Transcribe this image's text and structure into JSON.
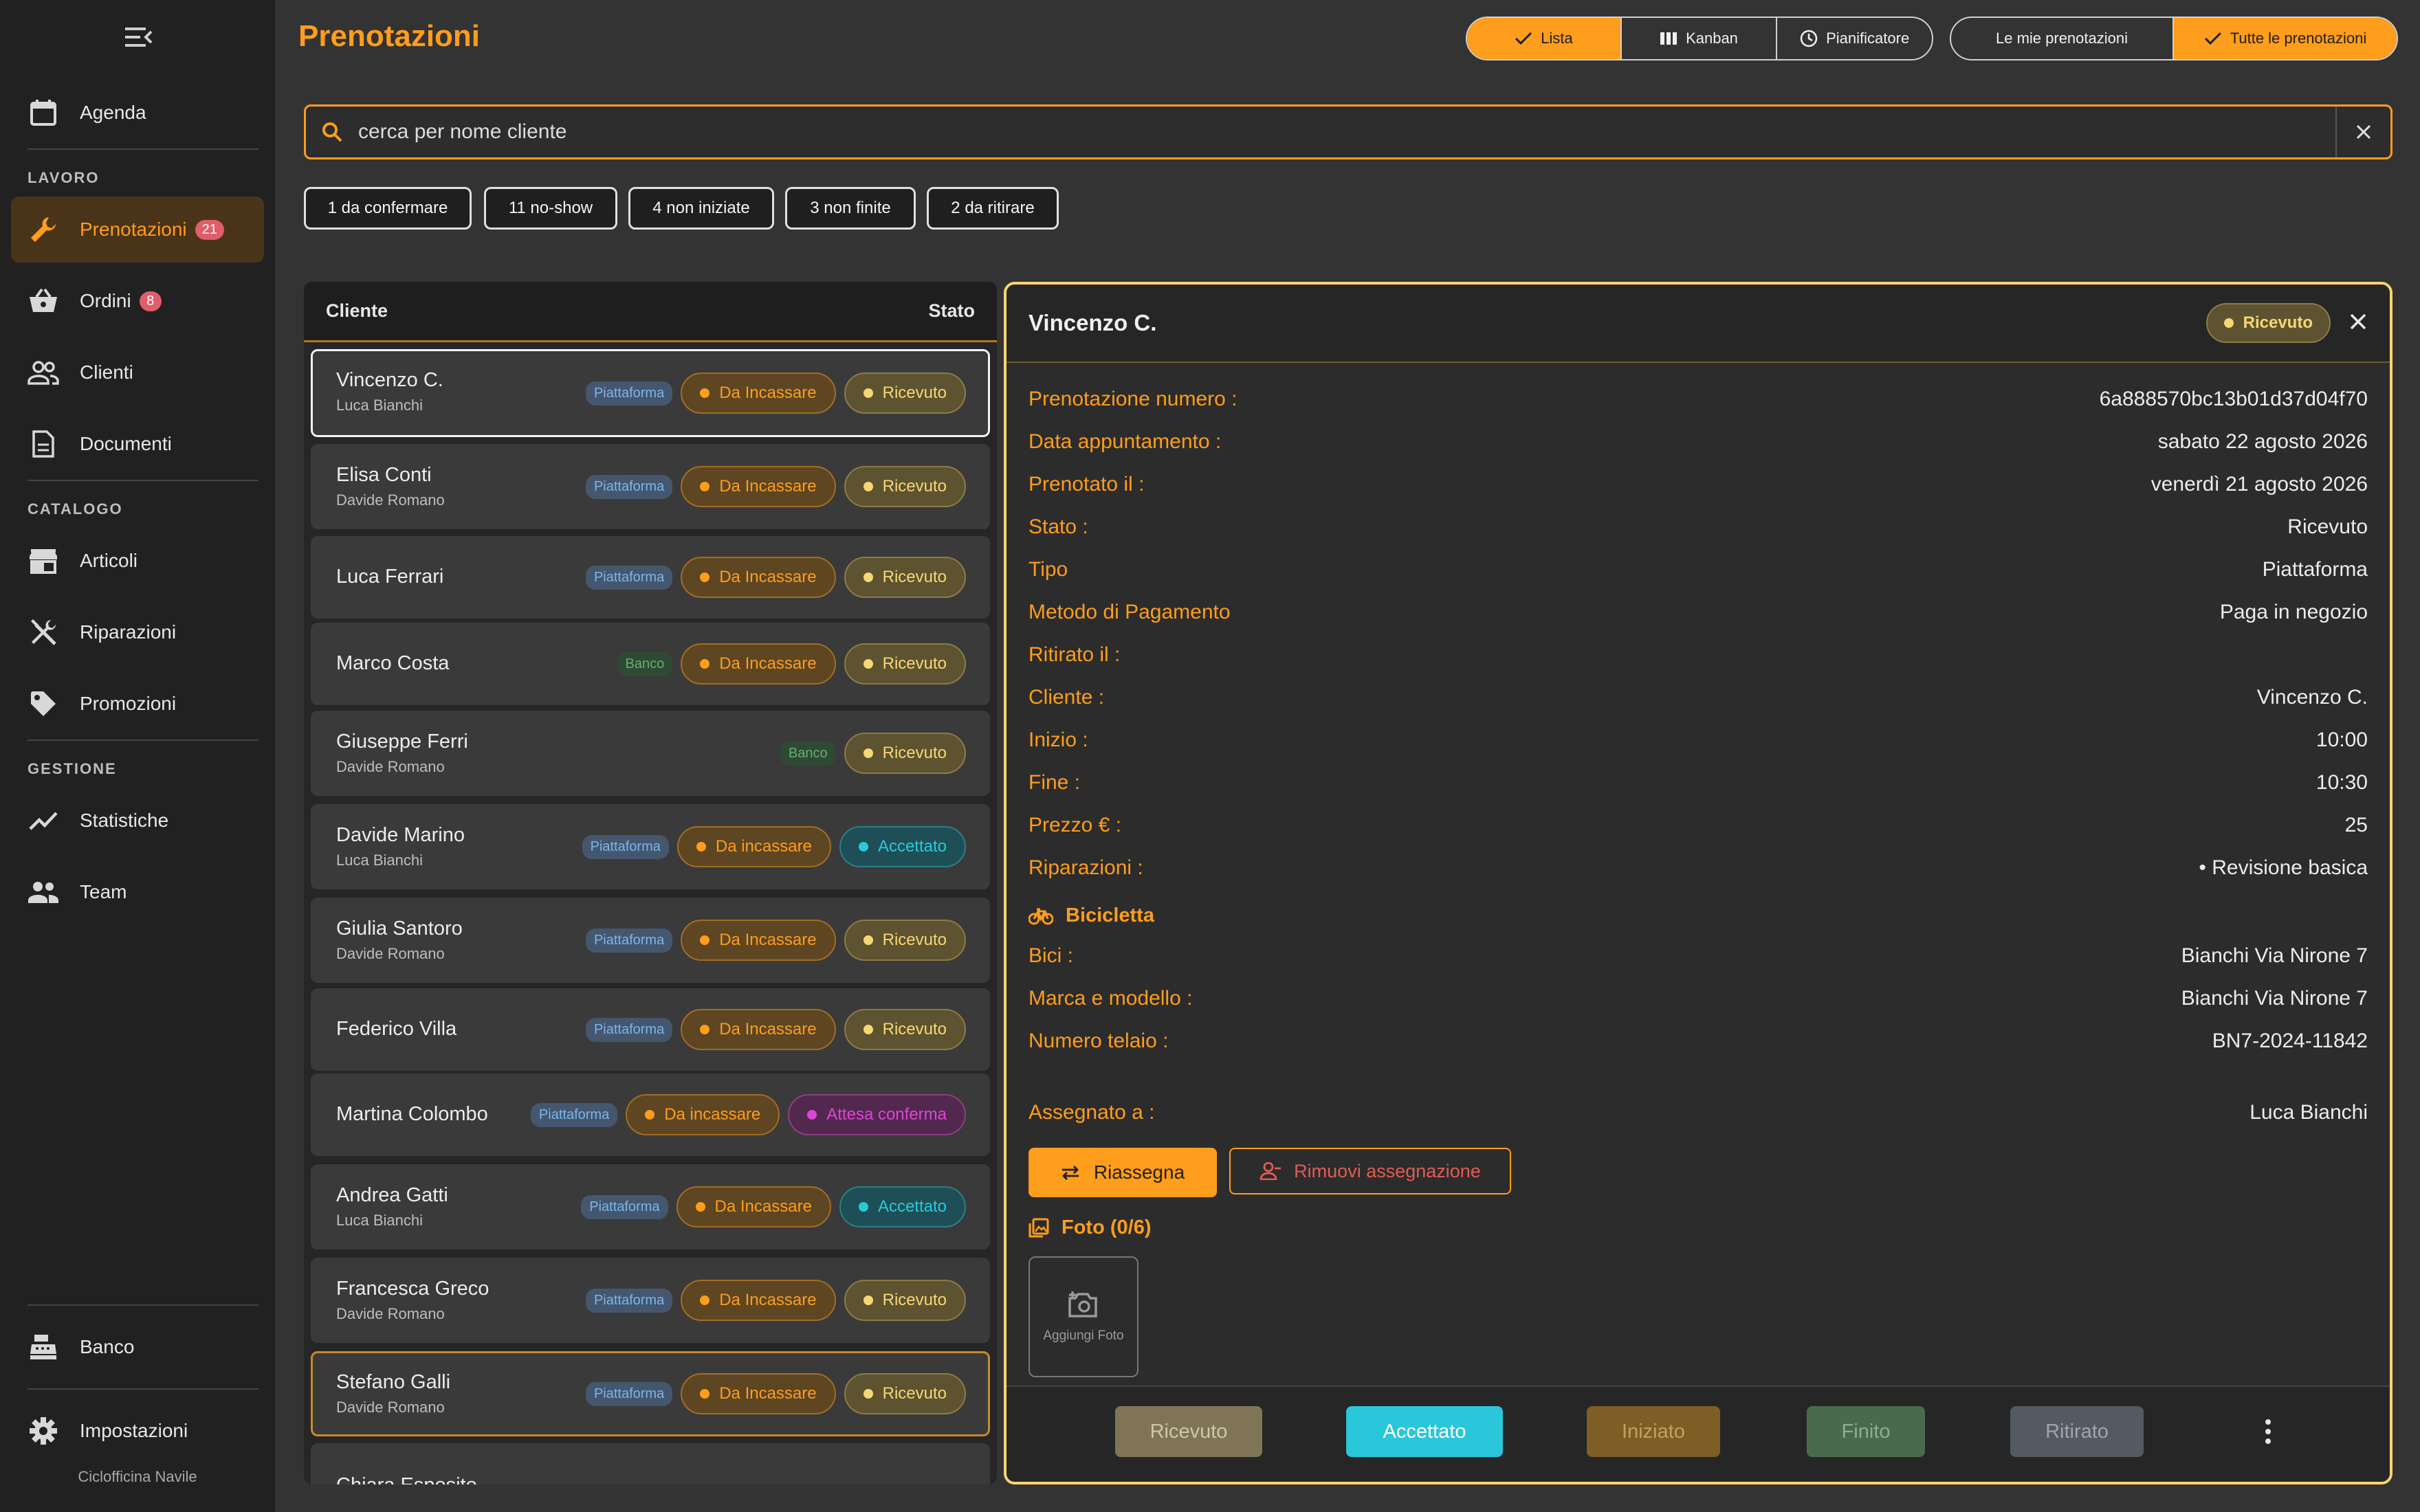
{
  "sidebar": {
    "shop_name": "Ciclofficina Navile",
    "agenda": "Agenda",
    "section_work": "LAVORO",
    "prenotazioni": "Prenotazioni",
    "prenotazioni_badge": "21",
    "ordini": "Ordini",
    "ordini_badge": "8",
    "clienti": "Clienti",
    "documenti": "Documenti",
    "section_catalog": "CATALOGO",
    "articoli": "Articoli",
    "riparazioni": "Riparazioni",
    "promozioni": "Promozioni",
    "section_manage": "GESTIONE",
    "statistiche": "Statistiche",
    "team": "Team",
    "banco": "Banco",
    "impostazioni": "Impostazioni"
  },
  "header": {
    "title": "Prenotazioni",
    "views": {
      "lista": "Lista",
      "kanban": "Kanban",
      "pianificatore": "Pianificatore"
    },
    "filters": {
      "mine": "Le mie prenotazioni",
      "all": "Tutte le prenotazioni"
    }
  },
  "search": {
    "value": "cerca per nome cliente"
  },
  "chips": [
    "1 da confermare",
    "11 no-show",
    "4 non iniziate",
    "3 non finite",
    "2 da ritirare"
  ],
  "list": {
    "col_client": "Cliente",
    "col_status": "Stato",
    "rows": [
      {
        "name": "Vincenzo C.",
        "sub": "Luca Bianchi",
        "source": "Piattaforma",
        "payment": "Da Incassare",
        "status": "Ricevuto"
      },
      {
        "name": "Elisa Conti",
        "sub": "Davide Romano",
        "source": "Piattaforma",
        "payment": "Da Incassare",
        "status": "Ricevuto"
      },
      {
        "name": "Luca Ferrari",
        "sub": "",
        "source": "Piattaforma",
        "payment": "Da Incassare",
        "status": "Ricevuto"
      },
      {
        "name": "Marco Costa",
        "sub": "",
        "source": "Banco",
        "payment": "Da Incassare",
        "status": "Ricevuto"
      },
      {
        "name": "Giuseppe Ferri",
        "sub": "Davide Romano",
        "source": "Banco",
        "payment": "",
        "status": "Ricevuto"
      },
      {
        "name": "Davide Marino",
        "sub": "Luca Bianchi",
        "source": "Piattaforma",
        "payment": "Da incassare",
        "status": "Accettato"
      },
      {
        "name": "Giulia Santoro",
        "sub": "Davide Romano",
        "source": "Piattaforma",
        "payment": "Da Incassare",
        "status": "Ricevuto"
      },
      {
        "name": "Federico Villa",
        "sub": "",
        "source": "Piattaforma",
        "payment": "Da Incassare",
        "status": "Ricevuto"
      },
      {
        "name": "Martina Colombo",
        "sub": "",
        "source": "Piattaforma",
        "payment": "Da incassare",
        "status": "Attesa conferma"
      },
      {
        "name": "Andrea Gatti",
        "sub": "Luca Bianchi",
        "source": "Piattaforma",
        "payment": "Da Incassare",
        "status": "Accettato"
      },
      {
        "name": "Francesca Greco",
        "sub": "Davide Romano",
        "source": "Piattaforma",
        "payment": "Da Incassare",
        "status": "Ricevuto"
      },
      {
        "name": "Stefano Galli",
        "sub": "Davide Romano",
        "source": "Piattaforma",
        "payment": "Da Incassare",
        "status": "Ricevuto"
      },
      {
        "name": "Chiara Esposito",
        "sub": "",
        "source": "",
        "payment": "",
        "status": ""
      }
    ]
  },
  "detail": {
    "title": "Vincenzo C.",
    "badge": "Ricevuto",
    "fields": [
      {
        "k": "Prenotazione numero :",
        "v": "6a888570bc13b01d37d04f70"
      },
      {
        "k": "Data appuntamento :",
        "v": "sabato 22 agosto 2026"
      },
      {
        "k": "Prenotato il :",
        "v": "venerdì 21 agosto 2026"
      },
      {
        "k": "Stato :",
        "v": "Ricevuto"
      },
      {
        "k": "Tipo",
        "v": "Piattaforma"
      },
      {
        "k": "Metodo di Pagamento",
        "v": "Paga in negozio"
      },
      {
        "k": "Ritirato il :",
        "v": ""
      },
      {
        "k": "Cliente :",
        "v": "Vincenzo C."
      },
      {
        "k": "Inizio :",
        "v": "10:00"
      },
      {
        "k": "Fine :",
        "v": "10:30"
      },
      {
        "k": "Prezzo € :",
        "v": "25"
      },
      {
        "k": "Riparazioni :",
        "v": "• Revisione basica"
      }
    ],
    "bike_section": "Bicicletta",
    "bike_fields": [
      {
        "k": "Bici :",
        "v": "Bianchi Via Nirone 7"
      },
      {
        "k": "Marca e modello :",
        "v": "Bianchi Via Nirone 7"
      },
      {
        "k": "Numero telaio :",
        "v": "BN7-2024-11842"
      }
    ],
    "assigned_label": "Assegnato a :",
    "assigned_value": "Luca Bianchi",
    "reassign": "Riassegna",
    "remove": "Rimuovi assegnazione",
    "photos_section": "Foto (0/6)",
    "add_photo": "Aggiungi Foto",
    "status_buttons": [
      "Ricevuto",
      "Accettato",
      "Iniziato",
      "Finito",
      "Ritirato"
    ]
  },
  "colors": {
    "accent": "#ff9d1c",
    "received": "#f6d775",
    "accepted": "#29c9dc",
    "pending": "#de45d6"
  }
}
